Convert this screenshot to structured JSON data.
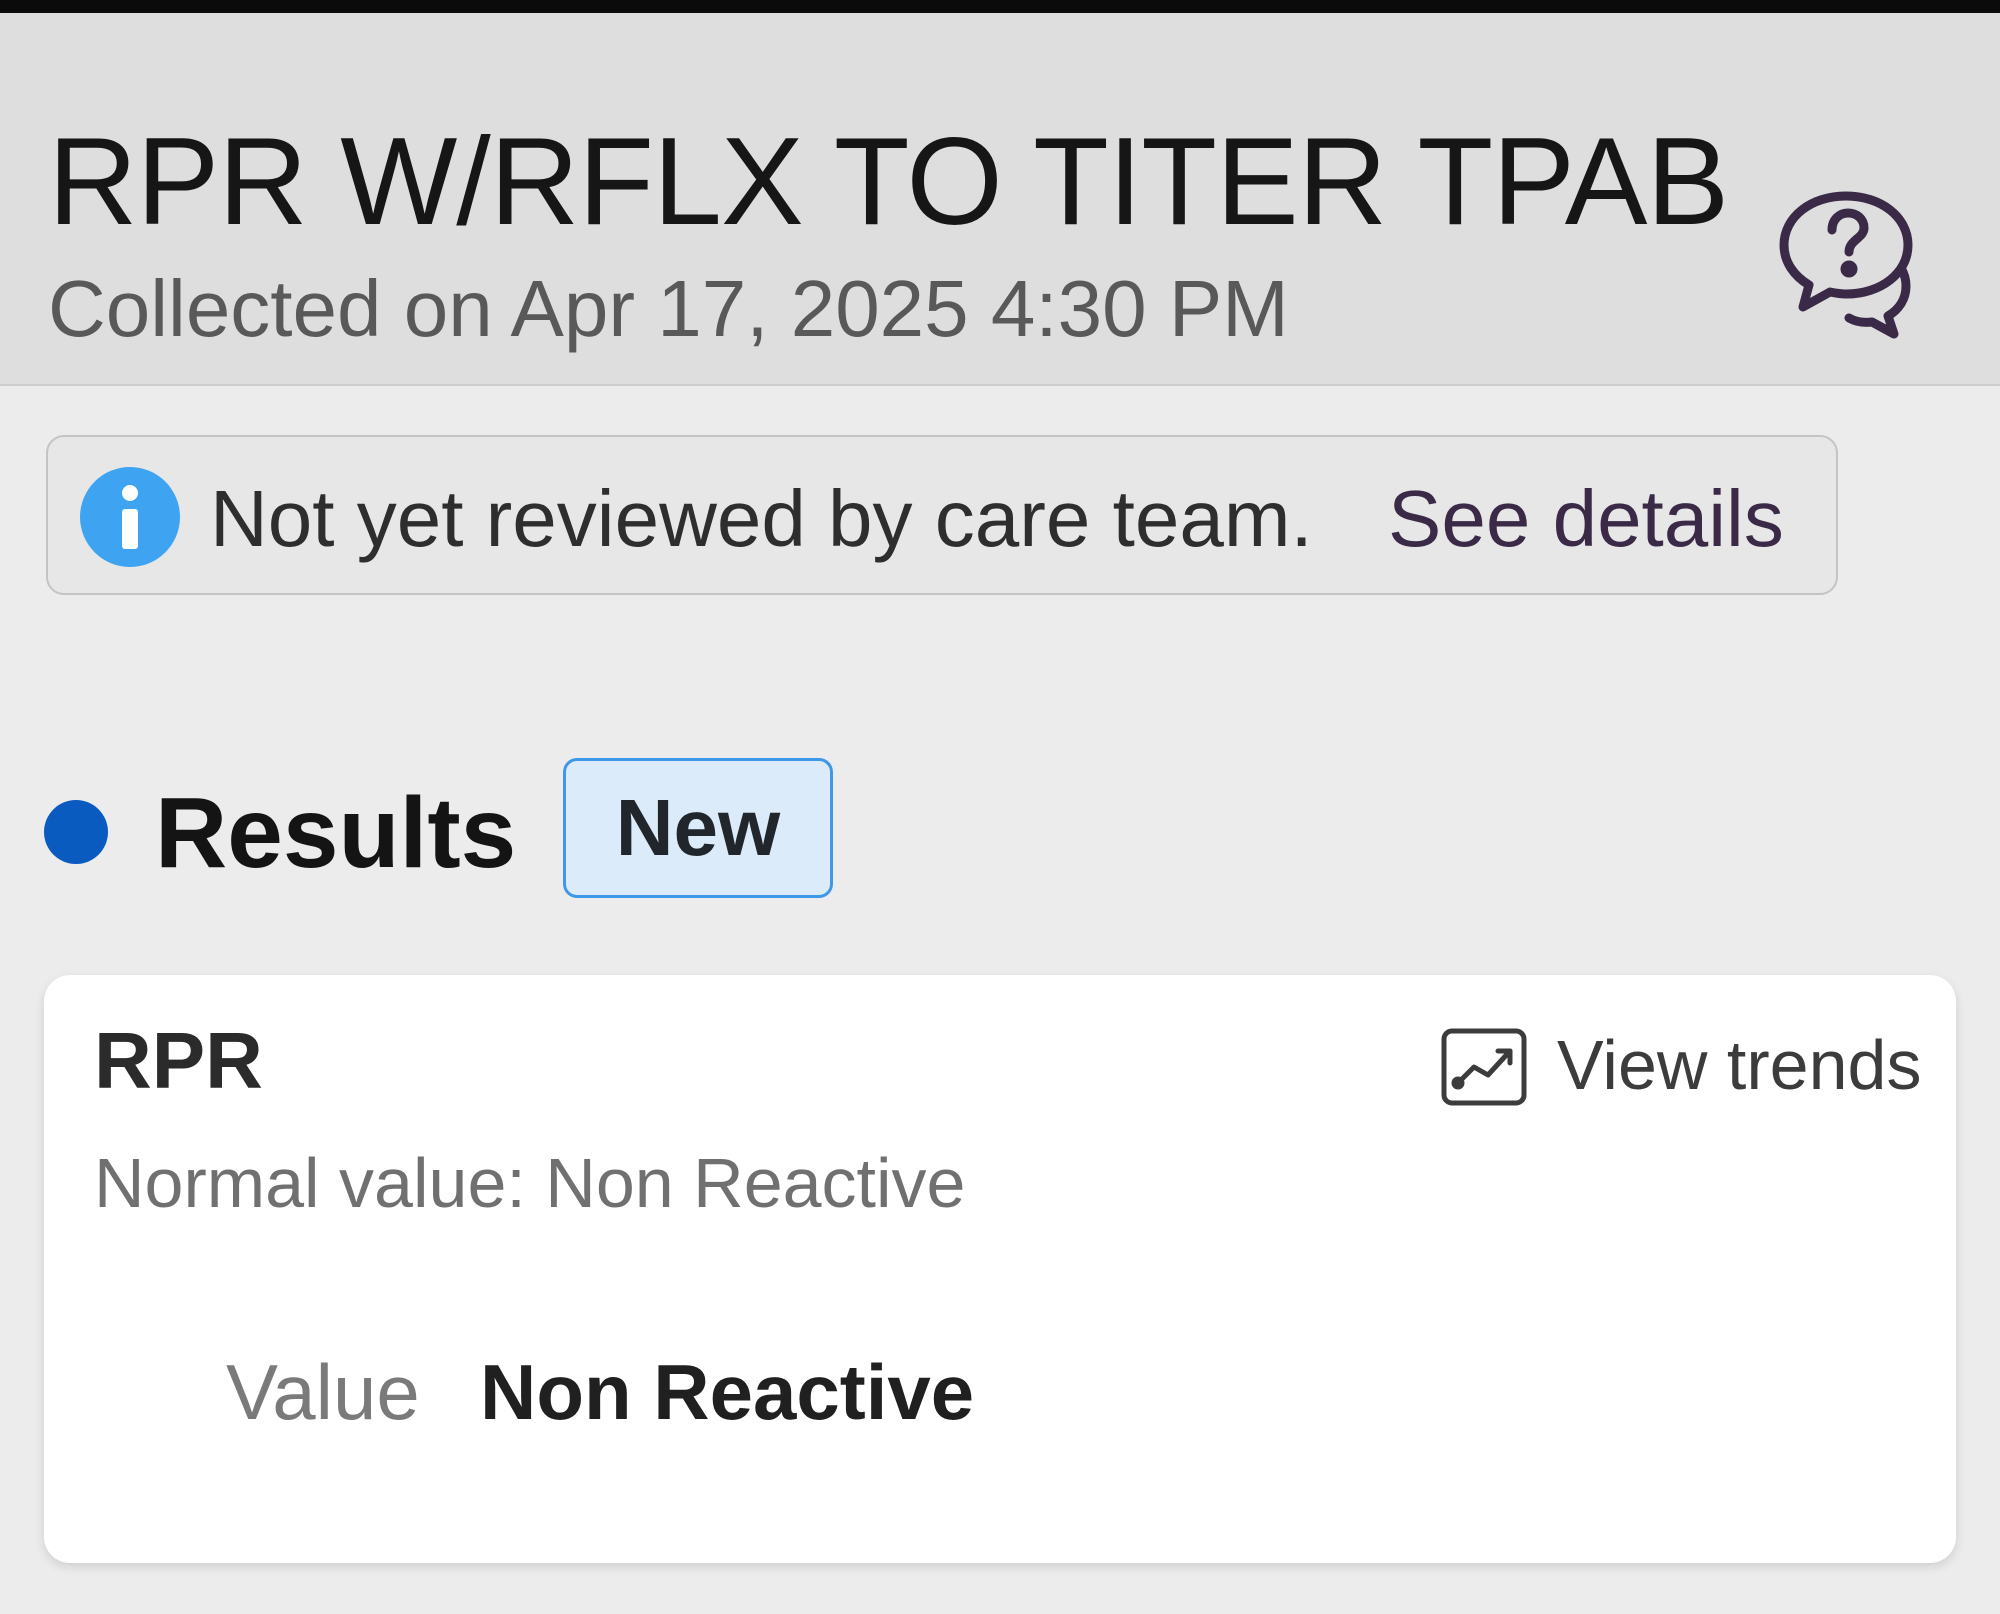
{
  "header": {
    "title": "RPR W/RFLX TO TITER TPAB",
    "subtitle": "Collected on Apr 17, 2025 4:30 PM",
    "help_icon": "question-chat-bubbles-icon"
  },
  "review_banner": {
    "icon": "info-icon",
    "message": "Not yet reviewed by care team.",
    "link_label": "See details"
  },
  "results": {
    "heading": "Results",
    "badge": "New",
    "items": [
      {
        "name": "RPR",
        "trends_label": "View trends",
        "trends_icon": "trend-chart-icon",
        "normal_value": "Normal value: Non Reactive",
        "value_label": "Value",
        "value": "Non Reactive"
      }
    ]
  },
  "colors": {
    "results_dot": "#0a5bbf",
    "info_icon": "#3ea4f2",
    "badge_border": "#3f97e8",
    "badge_bg": "#dcebf9",
    "link_text": "#3a2a48"
  }
}
